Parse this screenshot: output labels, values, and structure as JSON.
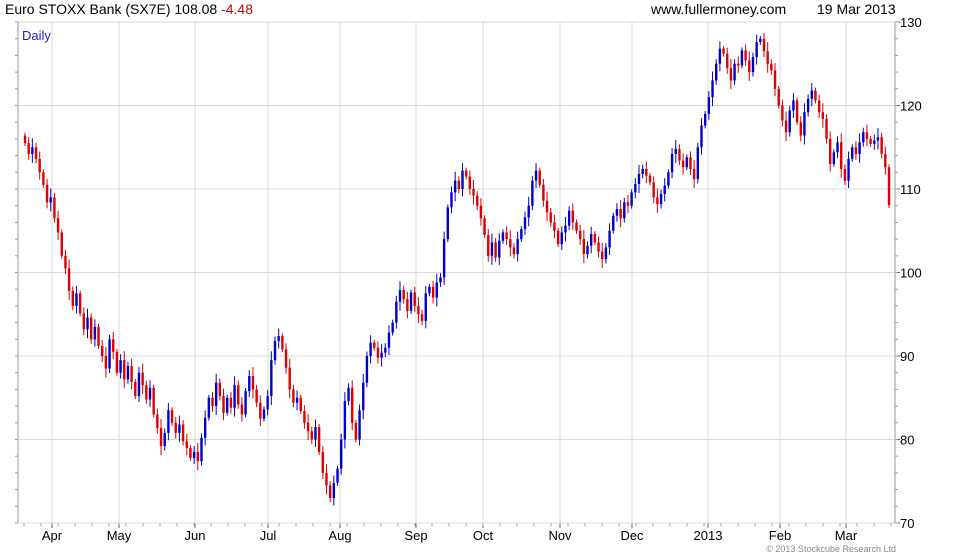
{
  "header": {
    "title": "Euro STOXX Bank (SX7E) 108.08",
    "change": "-4.48",
    "site": "www.fullermoney.com",
    "date": "19 Mar 2013"
  },
  "period_label": "Daily",
  "copyright": "© 2013 Stockcube Research Ltd",
  "chart_data": {
    "type": "candlestick",
    "title": "Euro STOXX Bank (SX7E)",
    "last": 108.08,
    "change": -4.48,
    "ylim": [
      70,
      130
    ],
    "yticks": [
      70,
      80,
      90,
      100,
      110,
      120,
      130
    ],
    "x_tick_labels": [
      "Apr",
      "May",
      "Jun",
      "Jul",
      "Aug",
      "Sep",
      "Oct",
      "Nov",
      "Dec",
      "2013",
      "Feb",
      "Mar"
    ],
    "up_color": "#0000cc",
    "down_color": "#dd0000",
    "grid": true,
    "close_series": [
      115.5,
      114.2,
      115.0,
      113.6,
      112.0,
      110.5,
      108.4,
      109.0,
      106.5,
      104.8,
      102.0,
      100.5,
      97.8,
      96.0,
      97.5,
      95.1,
      93.2,
      94.6,
      92.0,
      93.5,
      91.2,
      90.0,
      88.5,
      92.0,
      90.5,
      88.0,
      89.5,
      87.2,
      88.8,
      86.9,
      85.2,
      88.0,
      86.5,
      84.8,
      86.2,
      83.0,
      81.4,
      79.2,
      80.8,
      83.5,
      82.0,
      80.8,
      81.8,
      79.8,
      79.0,
      77.8,
      78.5,
      77.4,
      80.2,
      82.6,
      85.0,
      84.0,
      86.8,
      85.2,
      83.2,
      85.0,
      83.8,
      86.5,
      84.2,
      83.0,
      85.8,
      87.6,
      86.0,
      84.4,
      82.5,
      83.6,
      85.2,
      89.5,
      91.8,
      92.4,
      90.8,
      88.6,
      86.0,
      84.4,
      85.0,
      83.4,
      82.0,
      81.0,
      80.0,
      81.5,
      78.5,
      76.0,
      74.5,
      73.0,
      74.8,
      76.5,
      80.0,
      84.6,
      86.2,
      82.0,
      80.0,
      83.5,
      86.8,
      90.0,
      91.6,
      91.0,
      89.8,
      90.4,
      91.0,
      92.8,
      94.0,
      96.5,
      97.9,
      96.8,
      95.4,
      97.6,
      96.0,
      95.0,
      94.2,
      97.5,
      98.3,
      97.0,
      98.8,
      99.4,
      104.0,
      107.8,
      109.6,
      111.0,
      110.0,
      112.2,
      111.5,
      110.0,
      109.2,
      108.0,
      106.5,
      104.5,
      102.0,
      103.6,
      101.8,
      103.8,
      104.8,
      104.0,
      103.0,
      102.2,
      104.0,
      105.2,
      106.6,
      108.0,
      111.0,
      112.2,
      110.5,
      108.6,
      107.2,
      106.0,
      105.0,
      103.4,
      104.8,
      105.6,
      107.4,
      106.0,
      105.0,
      104.0,
      102.2,
      103.2,
      104.6,
      103.6,
      102.5,
      101.6,
      103.0,
      105.0,
      106.8,
      107.6,
      106.5,
      108.4,
      108.0,
      109.6,
      110.6,
      111.8,
      112.4,
      111.6,
      110.8,
      109.0,
      108.2,
      109.4,
      110.4,
      112.0,
      114.2,
      114.8,
      113.4,
      112.6,
      113.8,
      112.4,
      111.2,
      115.0,
      117.6,
      119.0,
      121.0,
      123.0,
      125.0,
      126.8,
      126.2,
      124.5,
      123.0,
      125.0,
      124.8,
      126.6,
      125.4,
      124.0,
      125.8,
      127.6,
      128.0,
      126.5,
      125.0,
      124.2,
      122.0,
      120.0,
      118.2,
      116.8,
      119.4,
      120.6,
      118.0,
      116.4,
      119.2,
      120.8,
      121.8,
      120.6,
      119.2,
      118.4,
      116.0,
      113.0,
      114.4,
      115.6,
      112.4,
      111.0,
      113.6,
      115.0,
      114.2,
      115.6,
      116.8,
      116.0,
      115.4,
      115.8,
      116.2,
      114.2,
      112.6,
      108.08
    ]
  }
}
